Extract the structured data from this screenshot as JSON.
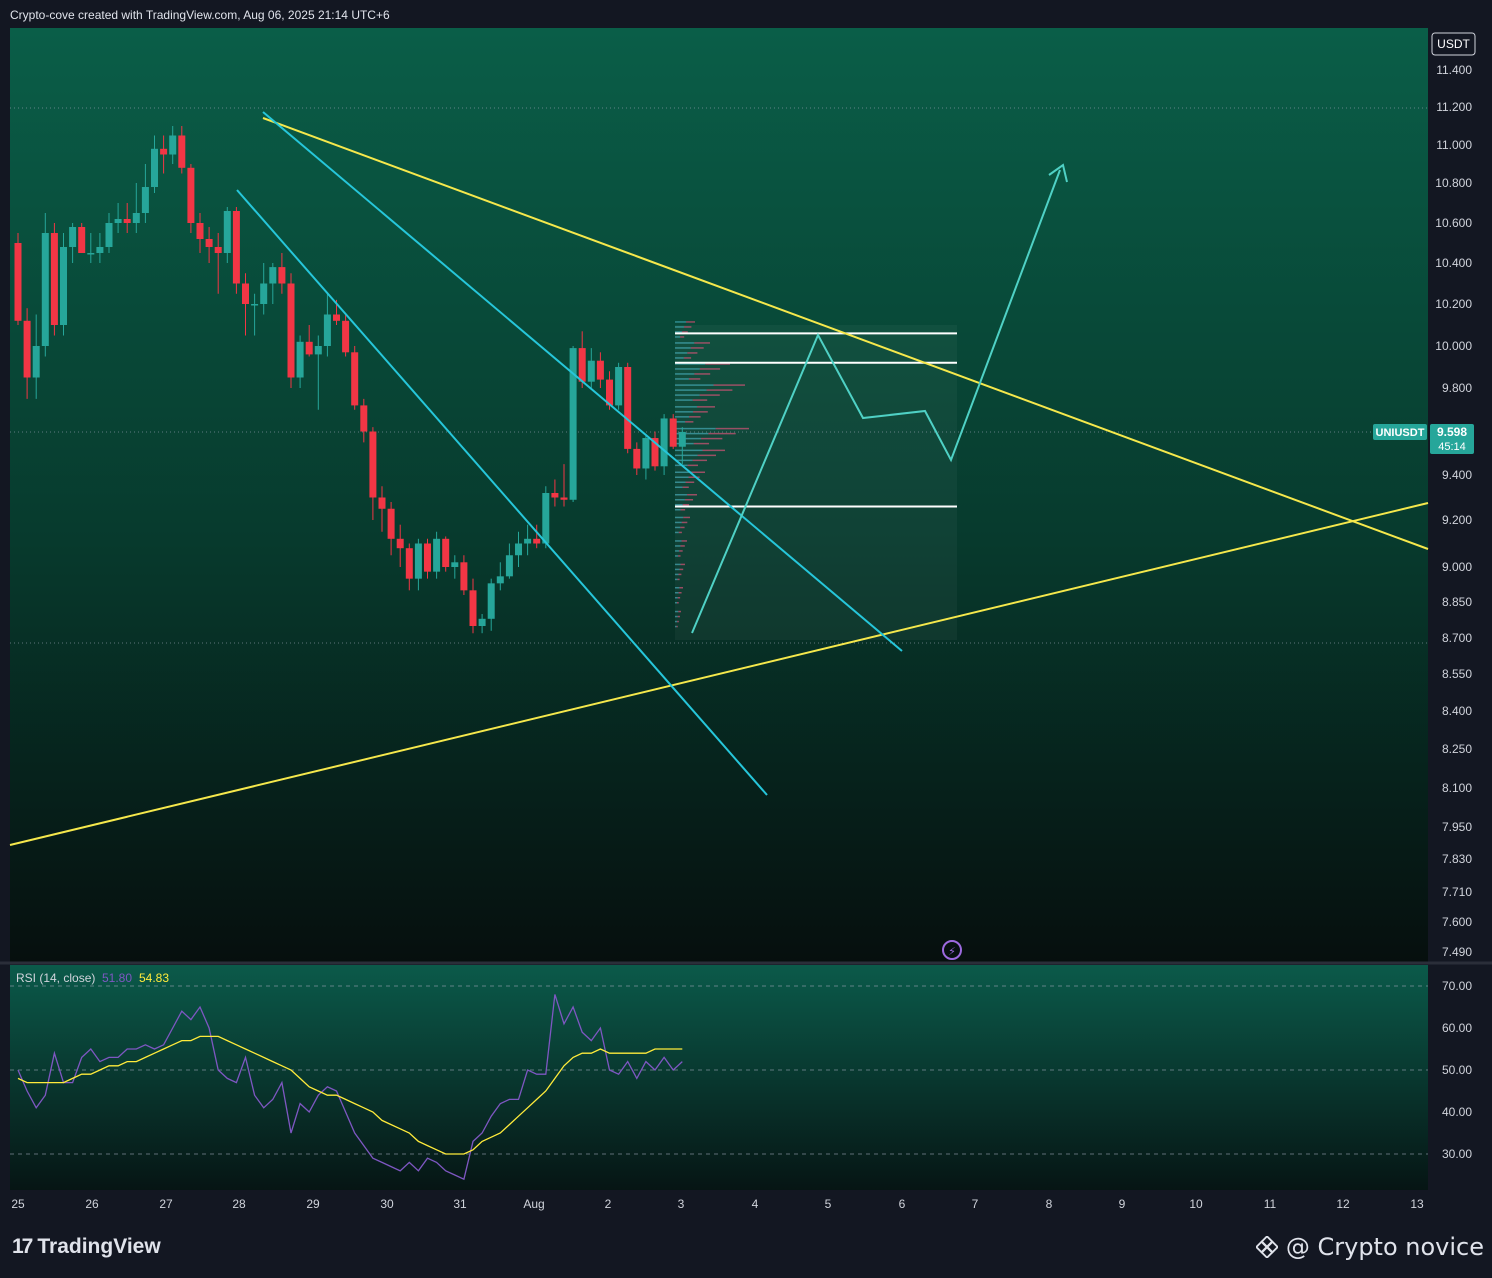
{
  "caption": "Crypto-cove created with TradingView.com, Aug 06, 2025 21:14 UTC+6",
  "footer": {
    "logo_text": "TradingView",
    "watermark": "@ Crypto novice"
  },
  "colors": {
    "up": "#26a69a",
    "down": "#f23645",
    "trend_yellow": "#f5e84c",
    "channel_cyan": "#26c6da",
    "rsi_line": "#7e57c2",
    "rsi_ma": "#ffeb3b",
    "price_tag": "#26a69a"
  },
  "chart_data": [
    {
      "type": "candlestick",
      "title": "",
      "symbol_label": "UNIUSDT",
      "currency_label": "USDT",
      "last_price": "9.598",
      "countdown": "45:14",
      "y_ticks": [
        "11.400",
        "11.200",
        "11.000",
        "10.800",
        "10.600",
        "10.400",
        "10.200",
        "10.000",
        "9.800",
        "9.400",
        "9.200",
        "9.000",
        "8.850",
        "8.700",
        "8.550",
        "8.400",
        "8.250",
        "8.100",
        "7.950",
        "7.830",
        "7.710",
        "7.600",
        "7.490"
      ],
      "x_ticks": [
        "25",
        "26",
        "27",
        "28",
        "29",
        "30",
        "31",
        "Aug",
        "2",
        "3",
        "4",
        "5",
        "6",
        "7",
        "8",
        "9",
        "10",
        "11",
        "12",
        "13"
      ],
      "ylim": [
        7.49,
        11.45
      ],
      "candles_ohlc": [
        [
          10.5,
          10.55,
          10.1,
          10.12
        ],
        [
          10.12,
          10.18,
          9.75,
          9.85
        ],
        [
          9.85,
          10.15,
          9.75,
          10.0
        ],
        [
          10.0,
          10.65,
          9.95,
          10.55
        ],
        [
          10.55,
          10.6,
          10.05,
          10.1
        ],
        [
          10.1,
          10.55,
          10.05,
          10.48
        ],
        [
          10.48,
          10.6,
          10.4,
          10.58
        ],
        [
          10.58,
          10.6,
          10.45,
          10.45
        ],
        [
          10.45,
          10.55,
          10.4,
          10.45
        ],
        [
          10.45,
          10.55,
          10.4,
          10.48
        ],
        [
          10.48,
          10.65,
          10.45,
          10.6
        ],
        [
          10.6,
          10.7,
          10.55,
          10.62
        ],
        [
          10.62,
          10.7,
          10.55,
          10.6
        ],
        [
          10.6,
          10.8,
          10.55,
          10.65
        ],
        [
          10.65,
          10.9,
          10.6,
          10.78
        ],
        [
          10.78,
          11.05,
          10.75,
          10.98
        ],
        [
          10.98,
          11.05,
          10.85,
          10.95
        ],
        [
          10.95,
          11.1,
          10.9,
          11.05
        ],
        [
          11.05,
          11.1,
          10.85,
          10.88
        ],
        [
          10.88,
          10.9,
          10.55,
          10.6
        ],
        [
          10.6,
          10.65,
          10.45,
          10.52
        ],
        [
          10.52,
          10.58,
          10.4,
          10.48
        ],
        [
          10.48,
          10.55,
          10.25,
          10.45
        ],
        [
          10.45,
          10.68,
          10.4,
          10.66
        ],
        [
          10.66,
          10.68,
          10.25,
          10.3
        ],
        [
          10.3,
          10.35,
          10.05,
          10.2
        ],
        [
          10.2,
          10.25,
          10.05,
          10.2
        ],
        [
          10.2,
          10.4,
          10.15,
          10.3
        ],
        [
          10.3,
          10.4,
          10.2,
          10.38
        ],
        [
          10.38,
          10.45,
          10.25,
          10.3
        ],
        [
          10.3,
          10.35,
          9.8,
          9.85
        ],
        [
          9.85,
          10.05,
          9.8,
          10.02
        ],
        [
          10.02,
          10.1,
          9.95,
          9.96
        ],
        [
          9.96,
          10.05,
          9.7,
          10.0
        ],
        [
          10.0,
          10.25,
          9.95,
          10.15
        ],
        [
          10.15,
          10.22,
          10.1,
          10.12
        ],
        [
          10.12,
          10.15,
          9.95,
          9.97
        ],
        [
          9.97,
          10.0,
          9.7,
          9.72
        ],
        [
          9.72,
          9.75,
          9.55,
          9.6
        ],
        [
          9.6,
          9.62,
          9.2,
          9.3
        ],
        [
          9.3,
          9.35,
          9.15,
          9.25
        ],
        [
          9.25,
          9.28,
          9.05,
          9.12
        ],
        [
          9.12,
          9.18,
          9.0,
          9.08
        ],
        [
          9.08,
          9.1,
          8.9,
          8.95
        ],
        [
          8.95,
          9.12,
          8.9,
          9.1
        ],
        [
          9.1,
          9.12,
          8.95,
          8.98
        ],
        [
          8.98,
          9.15,
          8.95,
          9.12
        ],
        [
          9.12,
          9.13,
          8.98,
          9.0
        ],
        [
          9.0,
          9.05,
          8.95,
          9.02
        ],
        [
          9.02,
          9.05,
          8.88,
          8.9
        ],
        [
          8.9,
          8.95,
          8.72,
          8.75
        ],
        [
          8.75,
          8.8,
          8.72,
          8.78
        ],
        [
          8.78,
          8.95,
          8.73,
          8.93
        ],
        [
          8.93,
          9.02,
          8.9,
          8.96
        ],
        [
          8.96,
          9.1,
          8.95,
          9.05
        ],
        [
          9.05,
          9.15,
          9.0,
          9.1
        ],
        [
          9.1,
          9.18,
          9.05,
          9.12
        ],
        [
          9.12,
          9.18,
          9.08,
          9.1
        ],
        [
          9.1,
          9.35,
          9.08,
          9.32
        ],
        [
          9.32,
          9.38,
          9.26,
          9.3
        ],
        [
          9.3,
          9.45,
          9.26,
          9.29
        ],
        [
          9.29,
          10.0,
          9.28,
          9.99
        ],
        [
          9.99,
          10.07,
          9.8,
          9.83
        ],
        [
          9.83,
          9.99,
          9.8,
          9.93
        ],
        [
          9.93,
          9.97,
          9.8,
          9.84
        ],
        [
          9.84,
          9.88,
          9.7,
          9.72
        ],
        [
          9.72,
          9.92,
          9.7,
          9.9
        ],
        [
          9.9,
          9.92,
          9.5,
          9.52
        ],
        [
          9.52,
          9.55,
          9.4,
          9.43
        ],
        [
          9.43,
          9.58,
          9.38,
          9.57
        ],
        [
          9.57,
          9.6,
          9.42,
          9.44
        ],
        [
          9.44,
          9.68,
          9.4,
          9.66
        ],
        [
          9.66,
          9.68,
          9.52,
          9.53
        ],
        [
          9.53,
          9.62,
          9.45,
          9.598
        ]
      ],
      "volume_profile_levels": [
        10.08,
        9.98,
        9.88,
        9.78,
        9.68,
        9.58,
        9.48,
        9.38,
        9.28,
        9.18,
        9.08,
        8.98,
        8.88,
        8.78
      ],
      "horizontal_levels": [
        10.06,
        9.92,
        9.26
      ]
    },
    {
      "type": "line",
      "title": "",
      "indicator_label": "RSI (14, close)",
      "rsi_value": "51.80",
      "rsi_ma_value": "54.83",
      "y_ticks": [
        "70.00",
        "60.00",
        "50.00",
        "40.00",
        "30.00"
      ],
      "ylim": [
        27,
        74
      ],
      "series": [
        {
          "values": [
            50,
            45,
            41,
            44,
            54,
            47,
            47,
            53,
            55,
            52,
            53,
            53,
            55,
            55,
            56,
            55,
            56,
            60,
            64,
            62,
            65,
            60,
            50,
            48,
            47,
            53,
            44,
            41,
            43,
            47,
            35,
            42,
            40,
            44,
            46,
            45,
            40,
            35,
            32,
            29,
            28,
            27,
            26,
            28,
            26,
            29,
            28,
            26,
            25,
            24,
            33,
            35,
            39,
            42,
            43,
            43,
            50,
            49,
            49,
            68,
            61,
            65,
            59,
            57,
            60,
            50,
            49,
            52,
            48,
            52,
            50,
            53,
            50,
            52
          ]
        },
        {
          "values": [
            48,
            47,
            47,
            47,
            47,
            47,
            48,
            49,
            49,
            50,
            51,
            51,
            52,
            52,
            53,
            54,
            55,
            56,
            57,
            57,
            58,
            58,
            58,
            57,
            56,
            55,
            54,
            53,
            52,
            51,
            50,
            48,
            46,
            45,
            44,
            44,
            43,
            42,
            41,
            40,
            38,
            37,
            36,
            35,
            33,
            32,
            31,
            30,
            30,
            30,
            31,
            33,
            34,
            35,
            37,
            39,
            41,
            43,
            45,
            48,
            51,
            53,
            54,
            54,
            55,
            54,
            54,
            54,
            54,
            54,
            55,
            55,
            55,
            55
          ]
        }
      ]
    }
  ]
}
